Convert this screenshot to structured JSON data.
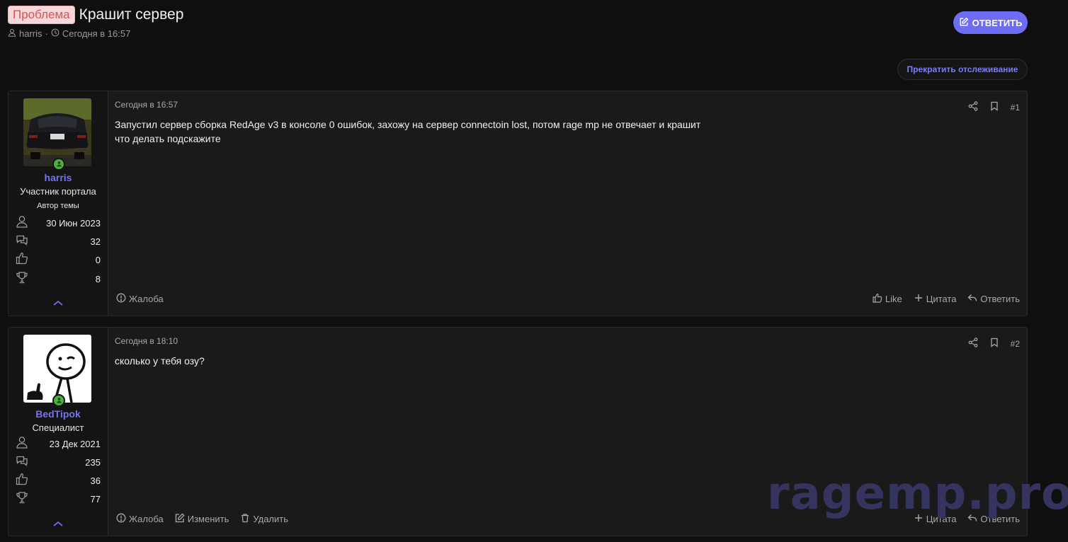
{
  "thread": {
    "prefix": "Проблема",
    "title": "Крашит сервер",
    "author": "harris",
    "date": "Сегодня в 16:57",
    "reply_label": "ОТВЕТИТЬ",
    "watch_label": "Прекратить отслеживание"
  },
  "posts": [
    {
      "number": "#1",
      "date": "Сегодня в 16:57",
      "body": [
        "Запустил сервер сборка RedAge v3 в консоле 0 ошибок, захожу на сервер connectoin lost, потом rage mp не отвечает и крашит",
        "что делать подскажите"
      ],
      "user": {
        "name": "harris",
        "title": "Участник портала",
        "banner": "Автор темы",
        "joined": "30 Июн 2023",
        "messages": "32",
        "reactions": "0",
        "points": "8"
      },
      "actions_left": [
        "Жалоба"
      ],
      "actions_right": [
        "Like",
        "Цитата",
        "Ответить"
      ]
    },
    {
      "number": "#2",
      "date": "Сегодня в 18:10",
      "body": [
        "сколько у тебя озу?"
      ],
      "user": {
        "name": "BedTipok",
        "title": "Специалист",
        "joined": "23 Дек 2021",
        "messages": "235",
        "reactions": "36",
        "points": "77"
      },
      "actions_left": [
        "Жалоба",
        "Изменить",
        "Удалить"
      ],
      "actions_right": [
        "Цитата",
        "Ответить"
      ]
    }
  ],
  "watermark": "ragemp.pro",
  "colors": {
    "background": "#0f0f0f",
    "panel": "#1a1a1a",
    "accent": "#6c6cf5",
    "username": "#7373f5",
    "prefix_text": "#d9534f",
    "prefix_bg": "#f8d7da",
    "online": "#4caf3f"
  }
}
